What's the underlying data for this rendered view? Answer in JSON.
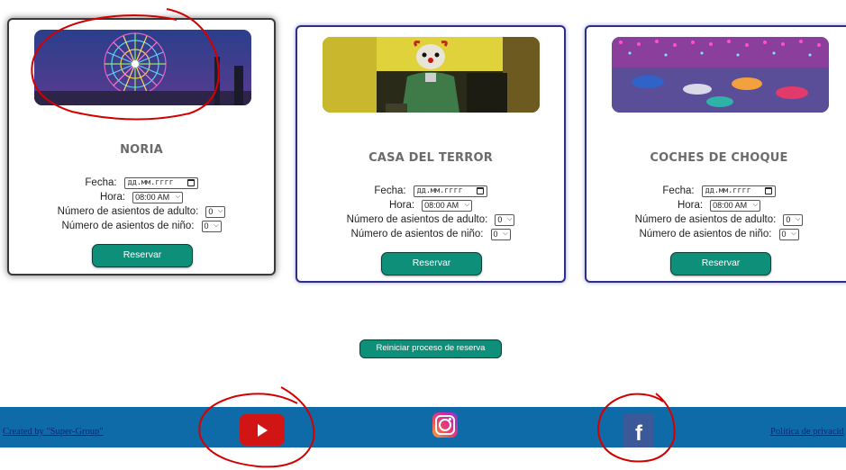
{
  "attractions": [
    {
      "title": "NORIA",
      "image": "ferris-wheel-photo",
      "fecha_label": "Fecha:",
      "date_placeholder": "дд.мм.гггг",
      "hora_label": "Hora:",
      "hora_value": "08:00 AM",
      "adult_label": "Número de asientos de adulto:",
      "adult_value": "0",
      "child_label": "Número de asientos de niño:",
      "child_value": "0",
      "button": "Reservar"
    },
    {
      "title": "CASA DEL TERROR",
      "image": "clown-photo",
      "fecha_label": "Fecha:",
      "date_placeholder": "дд.мм.гггг",
      "hora_label": "Hora:",
      "hora_value": "08:00 AM",
      "adult_label": "Número de asientos de adulto:",
      "adult_value": "0",
      "child_label": "Número de asientos de niño:",
      "child_value": "0",
      "button": "Reservar"
    },
    {
      "title": "COCHES DE CHOQUE",
      "image": "bumper-cars-photo",
      "fecha_label": "Fecha:",
      "date_placeholder": "дд.мм.гггг",
      "hora_label": "Hora:",
      "hora_value": "08:00 AM",
      "adult_label": "Número de asientos de adulto:",
      "adult_value": "0",
      "child_label": "Número de asientos de niño:",
      "child_value": "0",
      "button": "Reservar"
    }
  ],
  "reset_button": "Reiniciar proceso de reserva",
  "footer": {
    "credit": "Created by \"Super-Group\"",
    "policy": "Política de privacid",
    "social": [
      "youtube-icon",
      "instagram-icon",
      "facebook-icon"
    ],
    "facebook_glyph": "f",
    "colors": {
      "footer_bg": "#0e6ba8",
      "button_bg": "#0e8f7a",
      "annotation": "#d40000"
    }
  }
}
